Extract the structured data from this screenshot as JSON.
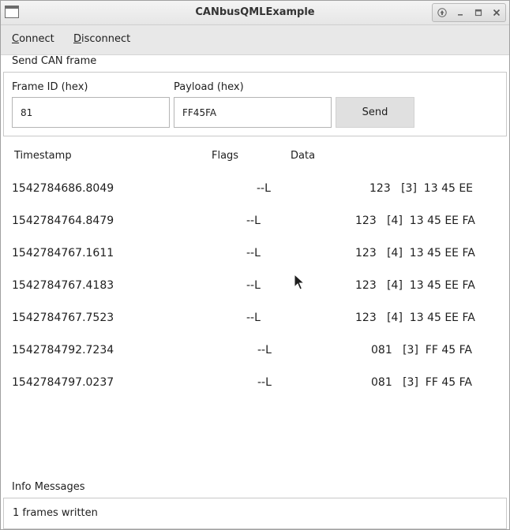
{
  "window": {
    "title": "CANbusQMLExample"
  },
  "menu": {
    "connect": {
      "mnemonic": "C",
      "rest": "onnect"
    },
    "disconnect": {
      "mnemonic": "D",
      "rest": "isconnect"
    }
  },
  "send": {
    "group_label": "Send CAN frame",
    "frame_id_label": "Frame ID (hex)",
    "frame_id_value": "81",
    "payload_label": "Payload (hex)",
    "payload_value": "FF45FA",
    "send_label": "Send"
  },
  "table": {
    "headers": {
      "timestamp": "Timestamp",
      "flags": "Flags",
      "data": "Data"
    },
    "rows": [
      {
        "timestamp": "1542784686.8049",
        "flags": "--L",
        "data": "123   [3]  13 45 EE"
      },
      {
        "timestamp": "1542784764.8479",
        "flags": "--L",
        "data": "123   [4]  13 45 EE FA"
      },
      {
        "timestamp": "1542784767.1611",
        "flags": "--L",
        "data": "123   [4]  13 45 EE FA"
      },
      {
        "timestamp": "1542784767.4183",
        "flags": "--L",
        "data": "123   [4]  13 45 EE FA"
      },
      {
        "timestamp": "1542784767.7523",
        "flags": "--L",
        "data": "123   [4]  13 45 EE FA"
      },
      {
        "timestamp": "1542784792.7234",
        "flags": "--L",
        "data": "081   [3]  FF 45 FA"
      },
      {
        "timestamp": "1542784797.0237",
        "flags": "--L",
        "data": "081   [3]  FF 45 FA"
      }
    ]
  },
  "info": {
    "label": "Info Messages",
    "message": "1 frames written"
  },
  "icons": {
    "app": "window-app-icon",
    "up": "arrow-up-icon",
    "minimize": "minimize-icon",
    "maximize": "maximize-icon",
    "close": "close-icon",
    "cursor": "mouse-pointer-icon"
  }
}
